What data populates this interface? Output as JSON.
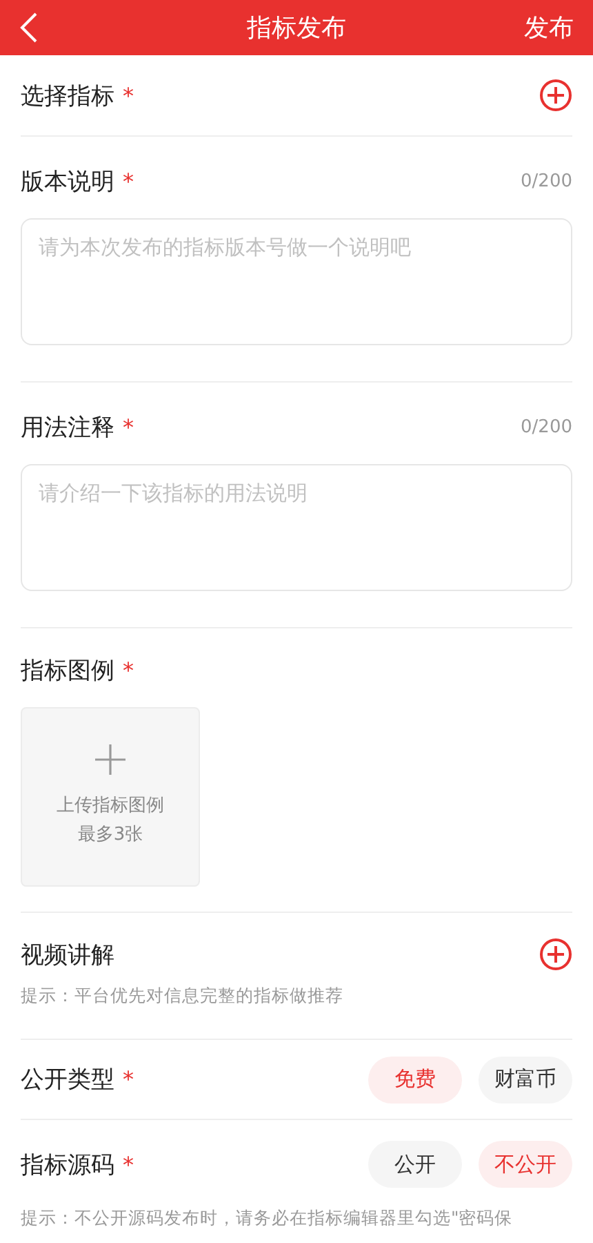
{
  "header": {
    "title": "指标发布",
    "action": "发布"
  },
  "sections": [
    {
      "kind": "add",
      "label": "选择指标",
      "mark": "*"
    },
    {
      "kind": "textarea",
      "label": "版本说明",
      "mark": "*",
      "counter": "0/200",
      "placeholder": "请为本次发布的指标版本号做一个说明吧"
    },
    {
      "kind": "textarea",
      "label": "用法注释",
      "mark": "*",
      "counter": "0/200",
      "placeholder": "请介绍一下该指标的用法说明"
    },
    {
      "kind": "upload",
      "label": "指标图例",
      "mark": "*",
      "upload_lines": [
        "上传指标图例",
        "最多3张"
      ]
    },
    {
      "kind": "add",
      "label": "视频讲解",
      "hint": "提示：平台优先对信息完整的指标做推荐"
    },
    {
      "kind": "choice",
      "label": "公开类型",
      "mark": "*",
      "options": [
        {
          "label": "免费",
          "selected": true
        },
        {
          "label": "财富币",
          "selected": false
        }
      ]
    },
    {
      "kind": "choice",
      "label": "指标源码",
      "mark": "*",
      "options": [
        {
          "label": "公开",
          "selected": false
        },
        {
          "label": "不公开",
          "selected": true
        }
      ],
      "hint": "提示：不公开源码发布时，请务必在指标编辑器里勾选\"密码保"
    }
  ]
}
